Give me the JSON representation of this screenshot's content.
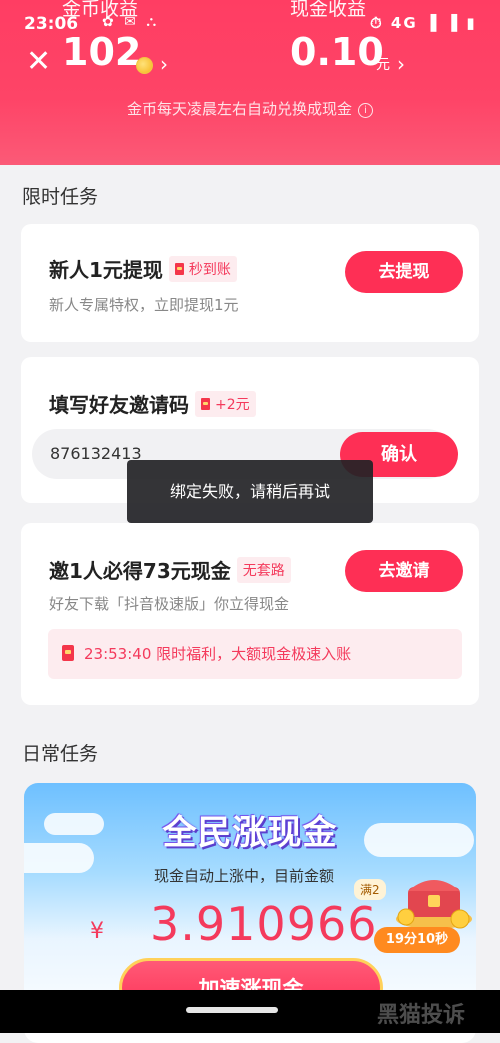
{
  "status_bar": {
    "time": "23:06",
    "left_icons": "✿ ✉ ⛬",
    "right_icons": "⏱ 4G ▐ ▐ ▮"
  },
  "header": {
    "coin_title": "金币收益",
    "cash_title": "现金收益",
    "coin_amount": "102",
    "cash_amount": "0.10",
    "cash_unit": "元",
    "notice": "金币每天凌晨左右自动兑换成现金",
    "chevron": "›",
    "close": "✕"
  },
  "limited_section": {
    "title": "限时任务"
  },
  "tasks": [
    {
      "title": "新人1元提现",
      "tag": "秒到账",
      "subtitle": "新人专属特权，立即提现1元",
      "button": "去提现"
    },
    {
      "title": "填写好友邀请码",
      "tag": "+2元",
      "input_value": "876132413",
      "button": "确认"
    },
    {
      "title": "邀1人必得73元现金",
      "tag": "无套路",
      "subtitle": "好友下载「抖音极速版」你立得现金",
      "button": "去邀请",
      "promo": "23:53:40 限时福利，大额现金极速入账"
    }
  ],
  "toast": "绑定失败，请稍后再试",
  "daily_section": {
    "title": "日常任务"
  },
  "daily_card": {
    "banner_title": "全民涨现金",
    "rise_text": "现金自动上涨中，目前金额",
    "currency": "¥",
    "amount": "3.910966",
    "full_tag": "满2",
    "timer": "19分10秒",
    "accel_button": "加速涨现金"
  },
  "watermark": "黑猫投诉",
  "colors": {
    "accent": "#fe2f55",
    "header": "#ff3d63",
    "tag_bg": "#fdecef"
  }
}
